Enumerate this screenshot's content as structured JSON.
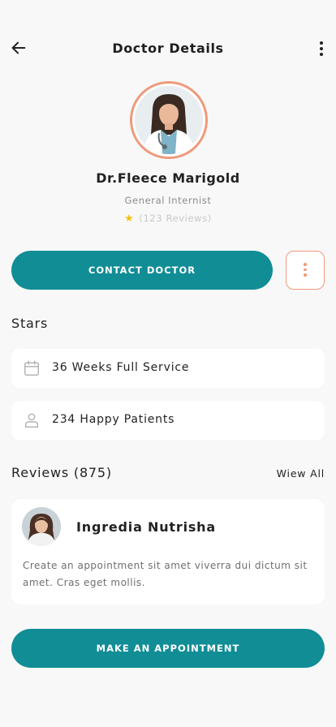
{
  "header": {
    "title": "Doctor Details",
    "back_icon": "arrow-left-icon",
    "menu_icon": "more-vertical-icon"
  },
  "doctor": {
    "name": "Dr.Fleece Marigold",
    "specialty": "General Internist",
    "rating_text": "(123 Reviews)",
    "star_icon": "star-icon"
  },
  "actions": {
    "contact_label": "CONTACT DOCTOR",
    "more_icon": "more-vertical-icon",
    "appointment_label": "MAKE AN APPOINTMENT"
  },
  "stars_section": {
    "title": "Stars",
    "items": [
      {
        "icon": "calendar-icon",
        "label": "36 Weeks Full Service"
      },
      {
        "icon": "user-icon",
        "label": "234 Happy Patients"
      }
    ]
  },
  "reviews_section": {
    "title": "Reviews (875)",
    "view_all_label": "Wiew All",
    "reviews": [
      {
        "name": "Ingredia Nutrisha",
        "text": "Create an appointment sit amet viverra dui dictum sit amet. Cras eget mollis."
      }
    ]
  },
  "colors": {
    "primary": "#118d96",
    "accent": "#ef9a7b",
    "star": "#f5c10f",
    "background": "#f8f8f8"
  }
}
